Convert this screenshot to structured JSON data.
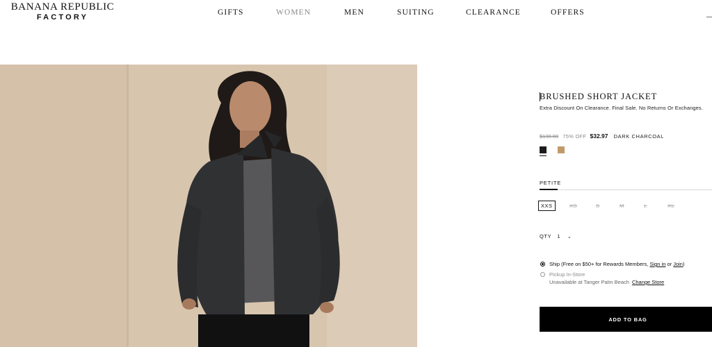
{
  "brand": {
    "line1": "BANANA REPUBLIC",
    "line2": "FACTORY"
  },
  "nav": {
    "items": [
      "GIFTS",
      "WOMEN",
      "MEN",
      "SUITING",
      "CLEARANCE",
      "OFFERS"
    ],
    "active": "WOMEN"
  },
  "product": {
    "title": "BRUSHED SHORT JACKET",
    "promo": "Extra Discount On Clearance. Final Sale. No Returns Or Exchanges.",
    "original_price": "$130.00",
    "discount": "75% OFF",
    "sale_price": "$32.97",
    "color_name": "DARK CHARCOAL",
    "swatches": [
      "#1c1c1c",
      "#c29a6a"
    ],
    "fit_tab": "PETITE",
    "sizes": [
      "XXS",
      "XS",
      "S",
      "M",
      "L",
      "XL"
    ],
    "selected_size": "XXS",
    "qty_label": "QTY",
    "qty_value": "1",
    "ship_text": "Ship (Free on $50+ for Rewards Members, ",
    "sign_in": "Sign in",
    "or": " or ",
    "join": "Join",
    "close_paren": ")",
    "pickup_text": "Pickup In-Store",
    "unavailable_text": "Unavailable at Tanger Palm Beach",
    "change_store": "Change Store",
    "add_to_bag": "ADD TO BAG"
  }
}
